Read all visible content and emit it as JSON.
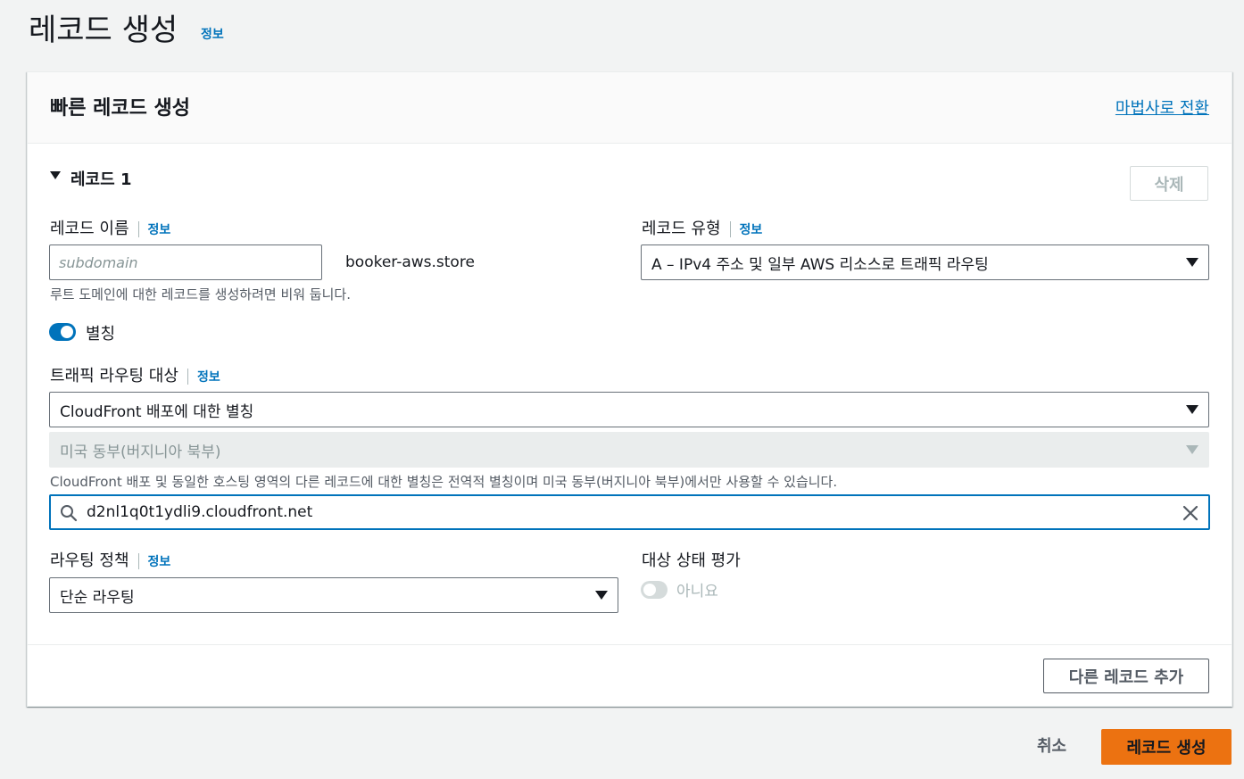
{
  "page": {
    "title": "레코드 생성",
    "info_label": "정보"
  },
  "card": {
    "title": "빠른 레코드 생성",
    "wizard_link": "마법사로 전환"
  },
  "record": {
    "title": "레코드 1",
    "delete_label": "삭제",
    "name_label": "레코드 이름",
    "name_info": "정보",
    "name_placeholder": "subdomain",
    "domain_suffix": "booker-aws.store",
    "name_hint": "루트 도메인에 대한 레코드를 생성하려면 비워 둡니다.",
    "type_label": "레코드 유형",
    "type_info": "정보",
    "type_value": "A – IPv4 주소 및 일부 AWS 리소스로 트래픽 라우팅",
    "alias_label": "별칭",
    "alias_on": true,
    "target_label": "트래픽 라우팅 대상",
    "target_info": "정보",
    "target_value": "CloudFront 배포에 대한 별칭",
    "region_value": "미국 동부(버지니아 북부)",
    "region_hint": "CloudFront 배포 및 동일한 호스팅 영역의 다른 레코드에 대한 별칭은 전역적 별칭이며 미국 동부(버지니아 북부)에서만 사용할 수 있습니다.",
    "search_value": "d2nl1q0t1ydli9.cloudfront.net",
    "policy_label": "라우팅 정책",
    "policy_info": "정보",
    "policy_value": "단순 라우팅",
    "health_label": "대상 상태 평가",
    "health_value": "아니요",
    "health_on": false
  },
  "footer": {
    "add_record_label": "다른 레코드 추가",
    "cancel_label": "취소",
    "create_label": "레코드 생성"
  },
  "colors": {
    "accent": "#0073bb",
    "primary_button": "#ec7211",
    "toggle_on": "#0073bb",
    "toggle_off": "#d5dbdb"
  }
}
